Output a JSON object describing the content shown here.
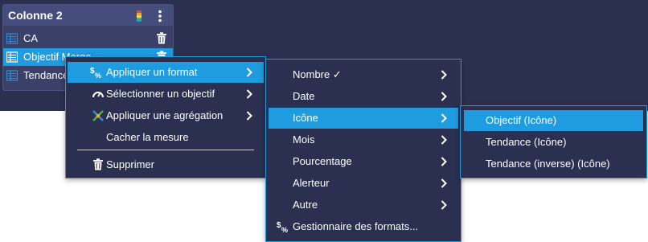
{
  "panel": {
    "title": "Colonne 2",
    "measures": [
      {
        "label": "CA",
        "icon": "measure-icon",
        "selected": false
      },
      {
        "label": "Objectif Marge",
        "icon": "measure-icon",
        "selected": true
      },
      {
        "label": "Tendance",
        "icon": "measure-icon",
        "selected": false
      }
    ]
  },
  "context_menu": {
    "items": [
      {
        "label": "Appliquer un format",
        "icon": "format-icon",
        "submenu": true,
        "active": true
      },
      {
        "label": "Sélectionner un objectif",
        "icon": "gauge-icon",
        "submenu": true
      },
      {
        "label": "Appliquer une agrégation",
        "icon": "aggregation-icon",
        "submenu": true
      },
      {
        "label": "Cacher la mesure",
        "submenu": false
      }
    ],
    "delete_label": "Supprimer"
  },
  "format_menu": {
    "items": [
      {
        "label": "Nombre ✓",
        "submenu": true
      },
      {
        "label": "Date",
        "submenu": true
      },
      {
        "label": "Icône",
        "submenu": true,
        "active": true
      },
      {
        "label": "Mois",
        "submenu": true
      },
      {
        "label": "Pourcentage",
        "submenu": true
      },
      {
        "label": "Alerteur",
        "submenu": true
      },
      {
        "label": "Autre",
        "submenu": true
      }
    ],
    "manager_label": "Gestionnaire des formats..."
  },
  "icon_menu": {
    "items": [
      {
        "label": "Objectif (Icône)",
        "active": true
      },
      {
        "label": "Tendance (Icône)"
      },
      {
        "label": "Tendance (inverse) (Icône)"
      }
    ]
  },
  "colors": {
    "background": "#2b3050",
    "panel": "#3a4068",
    "accent": "#1f9be0"
  }
}
